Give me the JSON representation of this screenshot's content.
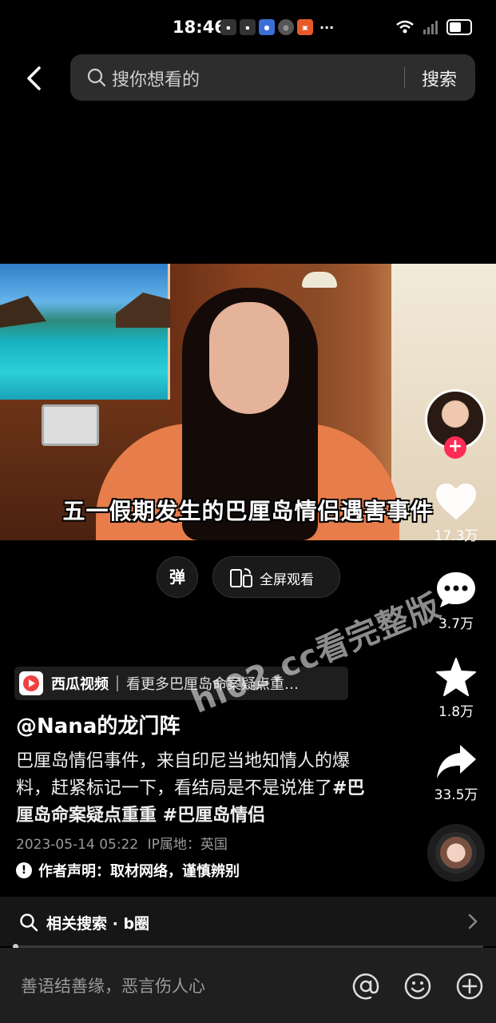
{
  "status_bar": {
    "time": "18:46",
    "app_icons": [
      "huawei-icon",
      "huawei-icon",
      "browser-icon",
      "hotspot-icon",
      "app-icon",
      "more-icon"
    ],
    "more": "···"
  },
  "header": {
    "search_placeholder": "搜你想看的",
    "search_button": "搜索"
  },
  "video": {
    "subtitle": "五一假期发生的巴厘岛情侣遇害事件",
    "danmaku_label": "弹",
    "fullscreen_label": "全屏观看"
  },
  "actions": {
    "likes": "17.3万",
    "comments": "3.7万",
    "favorites": "1.8万",
    "shares": "33.5万"
  },
  "source": {
    "app_name": "西瓜视频",
    "link_text": "看更多巴厘岛命案疑点重…"
  },
  "post": {
    "author": "@Nana的龙门阵",
    "description": "巴厘岛情侣事件，来自印尼当地知情人的爆料，赶紧标记一下，看结局是不是说准了",
    "tags": "#巴厘岛命案疑点重重 #巴厘岛情侣",
    "datetime": "2023-05-14 05:22",
    "ip_location": "IP属地：英国",
    "disclaimer": "作者声明：取材网络，谨慎辨别"
  },
  "watermark": "hl02.cc看完整版",
  "related": {
    "label": "相关搜索 · b圈"
  },
  "comment_bar": {
    "placeholder": "善语结善缘，恶言伤人心"
  },
  "colors": {
    "accent_red": "#fe2c55",
    "background": "#000000"
  }
}
